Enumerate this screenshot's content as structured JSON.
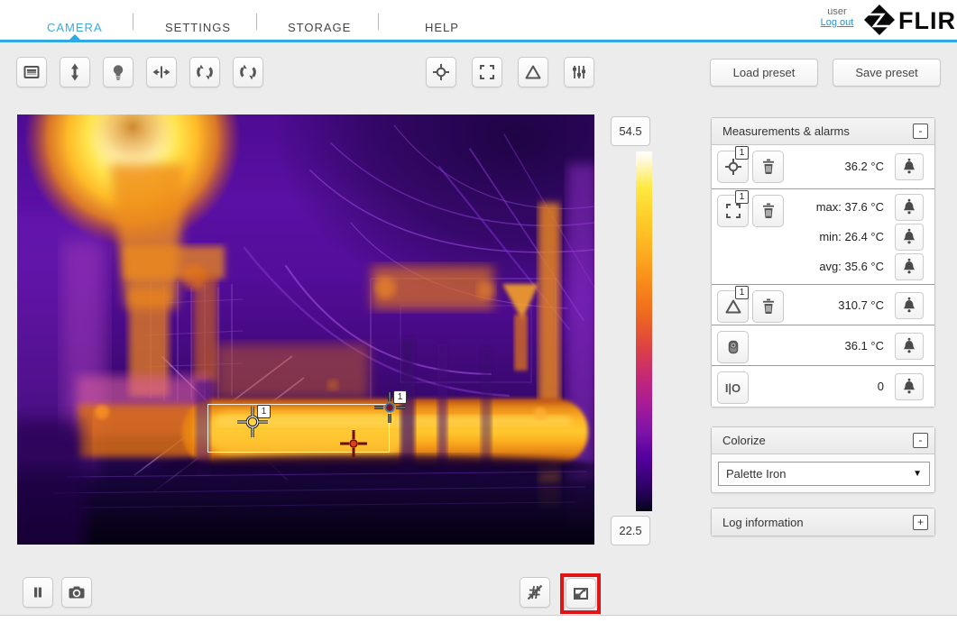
{
  "nav": {
    "items": [
      {
        "label": "CAMERA",
        "active": true
      },
      {
        "label": "SETTINGS",
        "active": false
      },
      {
        "label": "STORAGE",
        "active": false
      },
      {
        "label": "HELP",
        "active": false
      }
    ],
    "user_label": "user",
    "logout_label": "Log out",
    "brand": "FLIR"
  },
  "toolbar": {
    "left_icons": [
      "display-scale-icon",
      "vertical-adjust-icon",
      "lamp-icon",
      "horizontal-pan-icon",
      "rotate-icon",
      "rotate-icon"
    ],
    "center_icons": [
      "spot-meter-icon",
      "area-box-icon",
      "delta-icon",
      "sliders-icon"
    ],
    "load_preset_label": "Load preset",
    "save_preset_label": "Save preset"
  },
  "viewport": {
    "scale_max": "54.5",
    "scale_min": "22.5",
    "spot_marker_badge": "1",
    "delta_marker_badge": "1"
  },
  "measurements": {
    "title": "Measurements & alarms",
    "collapse_label": "-",
    "spot": {
      "badge": "1",
      "value": "36.2 °C"
    },
    "box": {
      "badge": "1",
      "values": [
        "max: 37.6 °C",
        "min: 26.4 °C",
        "avg: 35.6 °C"
      ]
    },
    "delta": {
      "badge": "1",
      "value": "310.7 °C"
    },
    "internal": {
      "value": "36.1 °C"
    },
    "io": {
      "label": "I|O",
      "value": "0"
    }
  },
  "colorize": {
    "title": "Colorize",
    "collapse_label": "-",
    "selected_palette": "Palette Iron"
  },
  "log_info": {
    "title": "Log information",
    "expand_label": "+"
  },
  "bottom_bar": {
    "icons": [
      "pause-icon",
      "snapshot-icon",
      "hide-overlay-icon",
      "fullscreen-icon"
    ]
  },
  "colors": {
    "accent_blue": "#2fa9e0",
    "highlight_red": "#e01616",
    "scale_top": "#ffffff",
    "scale_bottom": "#000000"
  }
}
